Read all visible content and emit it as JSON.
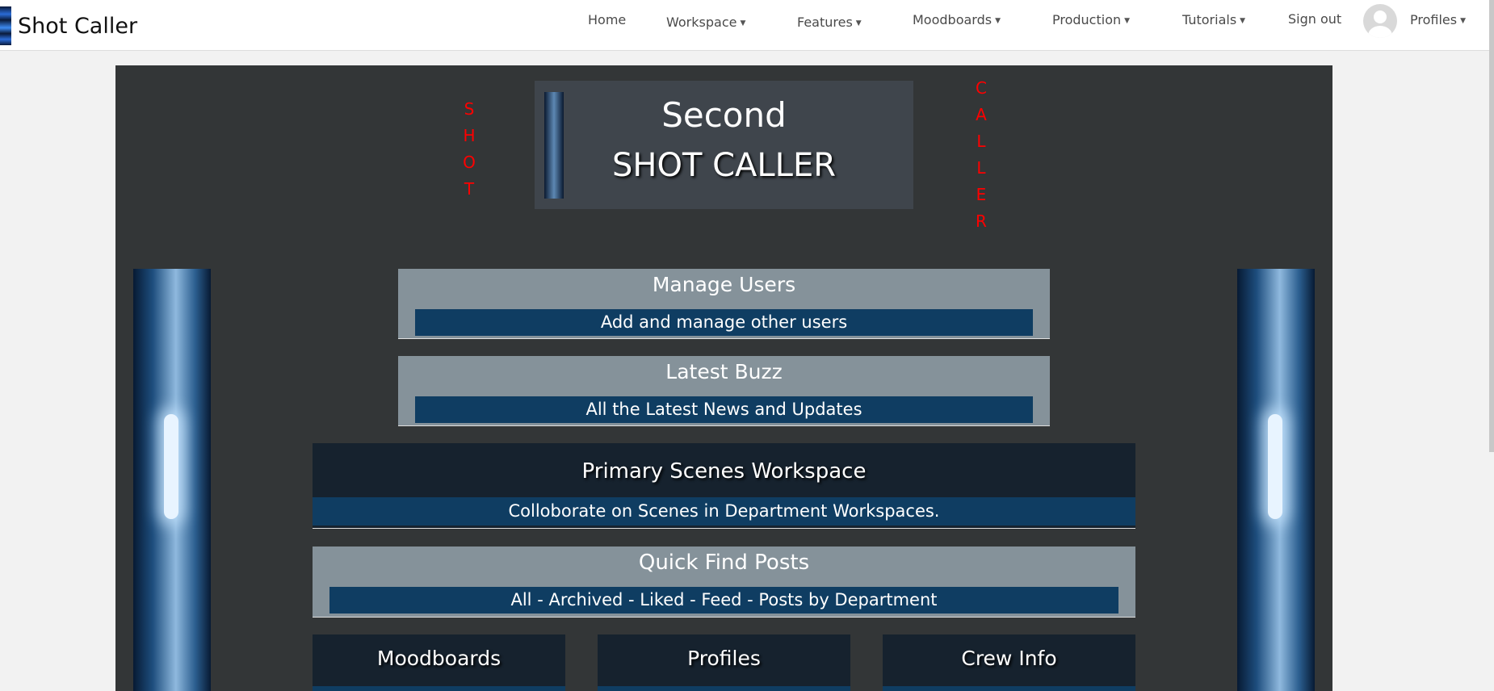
{
  "brand": {
    "name": "Shot Caller"
  },
  "nav": {
    "home": "Home",
    "workspace": "Workspace",
    "features": "Features",
    "moodboards": "Moodboards",
    "production": "Production",
    "tutorials": "Tutorials",
    "sign_out": "Sign out",
    "profiles": "Profiles"
  },
  "hero": {
    "title_line1": "Second",
    "title_line2": "SHOT CALLER",
    "left_letters": [
      "S",
      "H",
      "O",
      "T"
    ],
    "right_letters": [
      "C",
      "A",
      "L",
      "L",
      "E",
      "R"
    ],
    "letter_color": "#ff0000"
  },
  "cards": {
    "manage_users": {
      "title": "Manage Users",
      "subtitle": "Add and manage other users"
    },
    "latest_buzz": {
      "title": "Latest Buzz",
      "subtitle": "All the Latest News and Updates"
    },
    "primary_scenes": {
      "title": "Primary Scenes Workspace",
      "subtitle": "Colloborate on Scenes in Department Workspaces."
    },
    "quick_find": {
      "title": "Quick Find Posts",
      "subtitle": "All - Archived - Liked - Feed - Posts by Department"
    }
  },
  "tiles": {
    "moodboards": "Moodboards",
    "profiles": "Profiles",
    "crew_info": "Crew Info"
  },
  "colors": {
    "panel_bg": "#333637",
    "card_light": "#85929a",
    "card_dark": "#16222e",
    "subtitle_bar": "#0f3d62"
  }
}
